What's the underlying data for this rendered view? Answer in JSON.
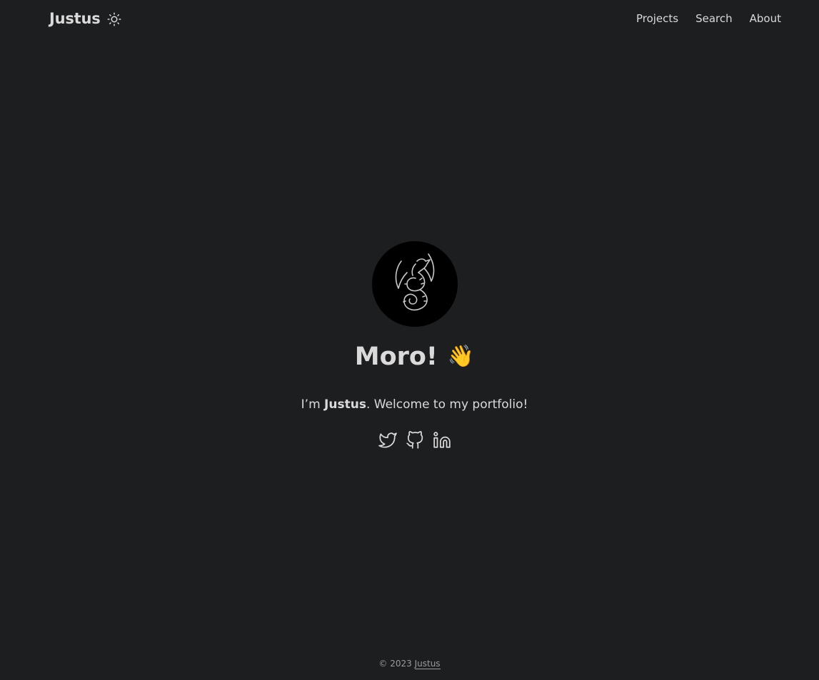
{
  "header": {
    "logo": "Justus",
    "theme_toggle_icon": "sun-icon",
    "nav": [
      "Projects",
      "Search",
      "About"
    ]
  },
  "main": {
    "avatar_icon": "dragon-icon",
    "title": "Moro!",
    "title_emoji": "👋",
    "intro_prefix": "I’m ",
    "intro_name": "Justus",
    "intro_suffix": ". Welcome to my portfolio!",
    "socials": [
      "twitter-icon",
      "github-icon",
      "linkedin-icon"
    ]
  },
  "footer": {
    "copyright": "© 2023 ",
    "author": "Justus"
  },
  "colors": {
    "background": "#1d1e20",
    "text": "#dadadb",
    "secondary": "#9b9c9d"
  }
}
